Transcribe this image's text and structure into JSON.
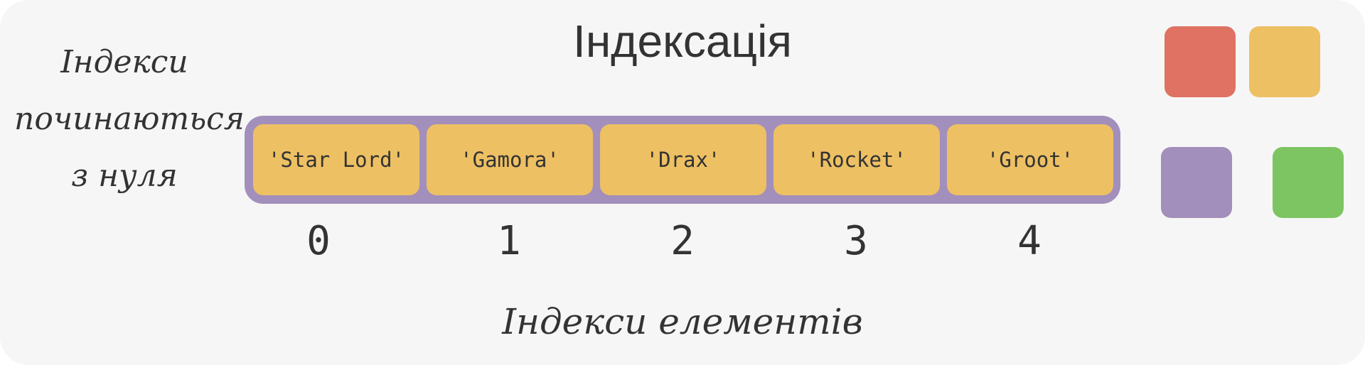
{
  "title": "Індексація",
  "side_note": [
    "Індекси",
    "починаються",
    "з нуля"
  ],
  "bottom_note": "Індекси елементів",
  "elements": [
    "'Star Lord'",
    "'Gamora'",
    "'Drax'",
    "'Rocket'",
    "'Groot'"
  ],
  "indices": [
    "0",
    "1",
    "2",
    "3",
    "4"
  ],
  "colors": {
    "background": "#f6f6f6",
    "array_frame": "#a28fbb",
    "cell": "#edc063",
    "text": "#333333"
  },
  "legend_swatches": [
    {
      "name": "red-swatch",
      "color": "#df7262"
    },
    {
      "name": "yellow-swatch",
      "color": "#edc063"
    },
    {
      "name": "purple-swatch",
      "color": "#a28fbb"
    },
    {
      "name": "green-swatch",
      "color": "#7dc462"
    }
  ]
}
